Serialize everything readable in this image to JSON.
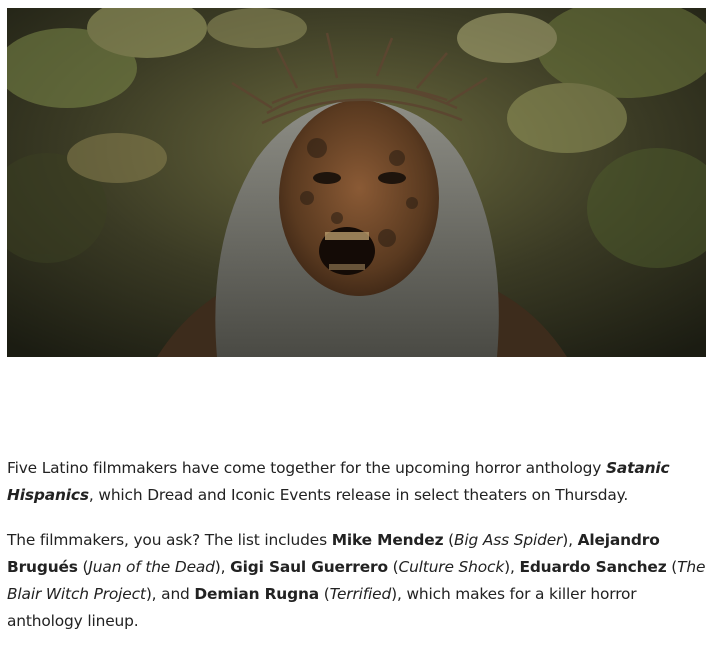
{
  "image": {
    "alt": "",
    "subject": "screaming-woman-with-thorn-crown"
  },
  "paragraphs": {
    "p1": {
      "t1": "Five Latino filmmakers have come together for the upcoming horror anthology ",
      "title": "Satanic Hispanics",
      "t2": ", which Dread and Iconic Events release in select theaters on Thursday."
    },
    "p2": {
      "t1": "The filmmakers, you ask? The list includes ",
      "n1": "Mike Mendez",
      "s1": " (",
      "m1": "Big Ass Spider",
      "s2": "), ",
      "n2": "Alejandro Brugués",
      "s3": " (",
      "m2": "Juan of the Dead",
      "s4": "), ",
      "n3": "Gigi Saul Guerrero",
      "s5": " (",
      "m3": "Culture Shock",
      "s6": "), ",
      "n4": "Eduardo Sanchez",
      "s7": " (",
      "m4": "The Blair Witch Project",
      "s8": "), and ",
      "n5": "Demian Rugna",
      "s9": " (",
      "m5": "Terrified",
      "s10": "), which makes for a killer horror anthology lineup."
    }
  }
}
